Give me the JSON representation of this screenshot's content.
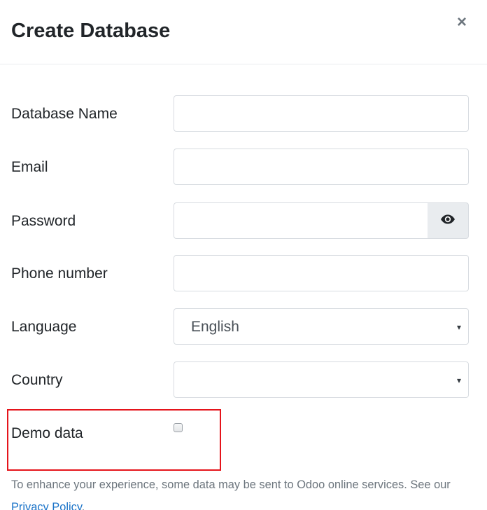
{
  "dialog": {
    "title": "Create Database",
    "close_label": "×"
  },
  "form": {
    "database_name": {
      "label": "Database Name",
      "value": ""
    },
    "email": {
      "label": "Email",
      "value": ""
    },
    "password": {
      "label": "Password",
      "value": "",
      "toggle_icon": "eye-icon"
    },
    "phone": {
      "label": "Phone number",
      "value": ""
    },
    "language": {
      "label": "Language",
      "value": "English",
      "caret": "▾"
    },
    "country": {
      "label": "Country",
      "value": "",
      "caret": "▾"
    },
    "demo_data": {
      "label": "Demo data",
      "checked": false
    }
  },
  "footer": {
    "notice_text": "To enhance your experience, some data may be sent to Odoo online services. See our ",
    "privacy_link": "Privacy Policy",
    "notice_end": "."
  },
  "colors": {
    "highlight_border": "#e5141b",
    "link": "#1a73c8"
  }
}
